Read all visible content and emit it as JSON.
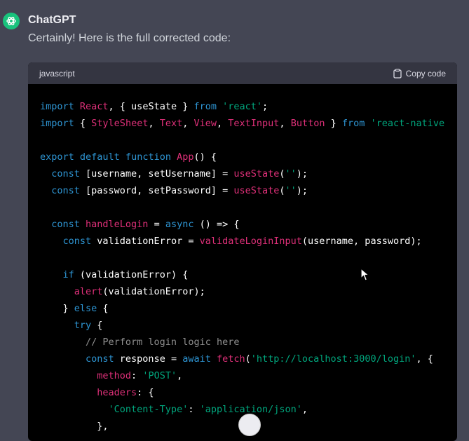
{
  "message": {
    "author": "ChatGPT",
    "intro": "Certainly! Here is the full corrected code:"
  },
  "codeblock": {
    "language": "javascript",
    "copy_label": "Copy code",
    "lines": [
      [
        {
          "t": "import ",
          "c": "kw"
        },
        {
          "t": "React",
          "c": "id"
        },
        {
          "t": ", { useState } ",
          "c": "pl"
        },
        {
          "t": "from ",
          "c": "kw"
        },
        {
          "t": "'react'",
          "c": "str"
        },
        {
          "t": ";",
          "c": "pl"
        }
      ],
      [
        {
          "t": "import ",
          "c": "kw"
        },
        {
          "t": "{ ",
          "c": "pl"
        },
        {
          "t": "StyleSheet",
          "c": "id"
        },
        {
          "t": ", ",
          "c": "pl"
        },
        {
          "t": "Text",
          "c": "id"
        },
        {
          "t": ", ",
          "c": "pl"
        },
        {
          "t": "View",
          "c": "id"
        },
        {
          "t": ", ",
          "c": "pl"
        },
        {
          "t": "TextInput",
          "c": "id"
        },
        {
          "t": ", ",
          "c": "pl"
        },
        {
          "t": "Button",
          "c": "id"
        },
        {
          "t": " } ",
          "c": "pl"
        },
        {
          "t": "from ",
          "c": "kw"
        },
        {
          "t": "'react-native",
          "c": "str"
        }
      ],
      [],
      [
        {
          "t": "export ",
          "c": "kw"
        },
        {
          "t": "default ",
          "c": "kw"
        },
        {
          "t": "function ",
          "c": "kw"
        },
        {
          "t": "App",
          "c": "id"
        },
        {
          "t": "() {",
          "c": "pl"
        }
      ],
      [
        {
          "t": "  const ",
          "c": "kw"
        },
        {
          "t": "[username, setUsername] = ",
          "c": "pl"
        },
        {
          "t": "useState",
          "c": "id"
        },
        {
          "t": "(",
          "c": "pl"
        },
        {
          "t": "''",
          "c": "str"
        },
        {
          "t": ");",
          "c": "pl"
        }
      ],
      [
        {
          "t": "  const ",
          "c": "kw"
        },
        {
          "t": "[password, setPassword] = ",
          "c": "pl"
        },
        {
          "t": "useState",
          "c": "id"
        },
        {
          "t": "(",
          "c": "pl"
        },
        {
          "t": "''",
          "c": "str"
        },
        {
          "t": ");",
          "c": "pl"
        }
      ],
      [],
      [
        {
          "t": "  const ",
          "c": "kw"
        },
        {
          "t": "handleLogin",
          "c": "id"
        },
        {
          "t": " = ",
          "c": "pl"
        },
        {
          "t": "async ",
          "c": "kw"
        },
        {
          "t": "() => {",
          "c": "pl"
        }
      ],
      [
        {
          "t": "    const ",
          "c": "kw"
        },
        {
          "t": "validationError = ",
          "c": "pl"
        },
        {
          "t": "validateLoginInput",
          "c": "id"
        },
        {
          "t": "(username, password);",
          "c": "pl"
        }
      ],
      [],
      [
        {
          "t": "    if ",
          "c": "kw"
        },
        {
          "t": "(validationError) {",
          "c": "pl"
        }
      ],
      [
        {
          "t": "      alert",
          "c": "id"
        },
        {
          "t": "(validationError);",
          "c": "pl"
        }
      ],
      [
        {
          "t": "    } ",
          "c": "pl"
        },
        {
          "t": "else ",
          "c": "kw"
        },
        {
          "t": "{",
          "c": "pl"
        }
      ],
      [
        {
          "t": "      try ",
          "c": "kw"
        },
        {
          "t": "{",
          "c": "pl"
        }
      ],
      [
        {
          "t": "        // Perform login logic here",
          "c": "cm"
        }
      ],
      [
        {
          "t": "        const ",
          "c": "kw"
        },
        {
          "t": "response = ",
          "c": "pl"
        },
        {
          "t": "await ",
          "c": "kw"
        },
        {
          "t": "fetch",
          "c": "id"
        },
        {
          "t": "(",
          "c": "pl"
        },
        {
          "t": "'http://localhost:3000/login'",
          "c": "str"
        },
        {
          "t": ", {",
          "c": "pl"
        }
      ],
      [
        {
          "t": "          method",
          "c": "id"
        },
        {
          "t": ": ",
          "c": "pl"
        },
        {
          "t": "'POST'",
          "c": "str"
        },
        {
          "t": ",",
          "c": "pl"
        }
      ],
      [
        {
          "t": "          headers",
          "c": "id"
        },
        {
          "t": ": {",
          "c": "pl"
        }
      ],
      [
        {
          "t": "            'Content-Type'",
          "c": "str"
        },
        {
          "t": ": ",
          "c": "pl"
        },
        {
          "t": "'application/json'",
          "c": "str"
        },
        {
          "t": ",",
          "c": "pl"
        }
      ],
      [
        {
          "t": "          },",
          "c": "pl"
        }
      ]
    ]
  },
  "icons": {
    "avatar": "openai-logo-icon",
    "copy": "clipboard-icon",
    "cursor": "mouse-pointer-icon"
  },
  "colors": {
    "background": "#444654",
    "avatar": "#19c37d",
    "keyword": "#2e95d3",
    "identifier": "#df3079",
    "string": "#00a67d",
    "comment": "#8f8f8f"
  }
}
